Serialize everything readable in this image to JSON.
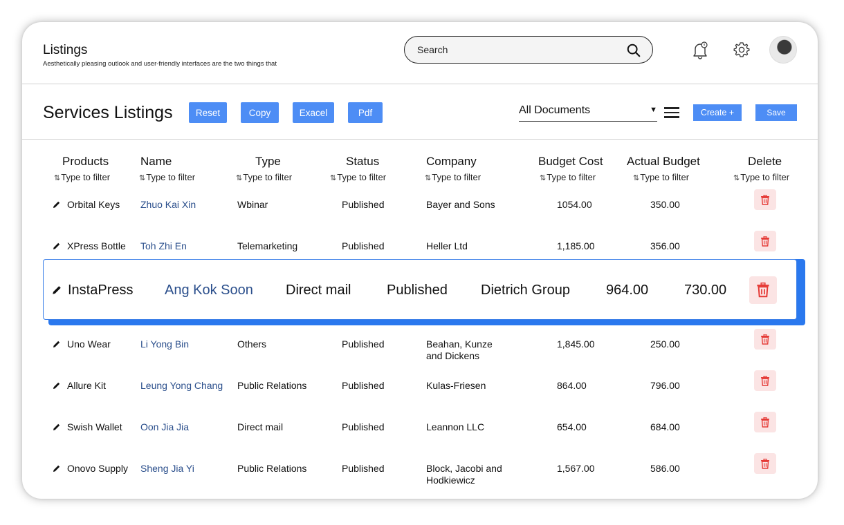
{
  "header": {
    "title": "Listings",
    "subtitle": "Aesthetically pleasing outlook and user-friendly interfaces are the two things that",
    "search_placeholder": "Search"
  },
  "toolbar": {
    "page_title": "Services Listings",
    "reset_label": "Reset",
    "copy_label": "Copy",
    "excel_label": "Exacel",
    "pdf_label": "Pdf",
    "document_filter": "All Documents",
    "create_label": "Create +",
    "save_label": "Save"
  },
  "table": {
    "columns": [
      {
        "label": "Products",
        "filter": "Type to filter"
      },
      {
        "label": "Name",
        "filter": "Type to filter"
      },
      {
        "label": "Type",
        "filter": "Type to filter"
      },
      {
        "label": "Status",
        "filter": "Type to filter"
      },
      {
        "label": "Company",
        "filter": "Type to filter"
      },
      {
        "label": "Budget Cost",
        "filter": "Type to filter"
      },
      {
        "label": "Actual Budget",
        "filter": "Type to filter"
      },
      {
        "label": "Delete",
        "filter": "Type to filter"
      }
    ],
    "rows": [
      {
        "product": "Orbital Keys",
        "name": "Zhuo Kai Xin",
        "type": "Wbinar",
        "status": "Published",
        "company": "Bayer and Sons",
        "budget": "1054.00",
        "actual": "350.00"
      },
      {
        "product": "XPress Bottle",
        "name": "Toh Zhi En",
        "type": "Telemarketing",
        "status": "Published",
        "company": "Heller Ltd",
        "budget": "1,185.00",
        "actual": "356.00"
      },
      {
        "product": "Uno Wear",
        "name": "Li Yong Bin",
        "type": "Others",
        "status": "Published",
        "company": "Beahan, Kunze and Dickens",
        "budget": "1,845.00",
        "actual": "250.00"
      },
      {
        "product": "Allure Kit",
        "name": "Leung Yong Chang",
        "type": "Public Relations",
        "status": "Published",
        "company": "Kulas-Friesen",
        "budget": "864.00",
        "actual": "796.00"
      },
      {
        "product": "Swish Wallet",
        "name": "Oon Jia Jia",
        "type": "Direct mail",
        "status": "Published",
        "company": "Leannon LLC",
        "budget": "654.00",
        "actual": "684.00"
      },
      {
        "product": "Onovo Supply",
        "name": "Sheng Jia Yi",
        "type": "Public Relations",
        "status": "Published",
        "company": "Block, Jacobi and Hodkiewicz",
        "budget": "1,567.00",
        "actual": "586.00"
      }
    ],
    "highlighted_row": {
      "product": "InstaPress",
      "name": "Ang Kok Soon",
      "type": "Direct mail",
      "status": "Published",
      "company": "Dietrich Group",
      "budget": "964.00",
      "actual": "730.00"
    }
  },
  "colors": {
    "accent": "#4d8df5",
    "highlight": "#2a78ee",
    "link": "#2b4f8c",
    "delete": "#e53935",
    "delete_bg": "#fbe4e4"
  }
}
